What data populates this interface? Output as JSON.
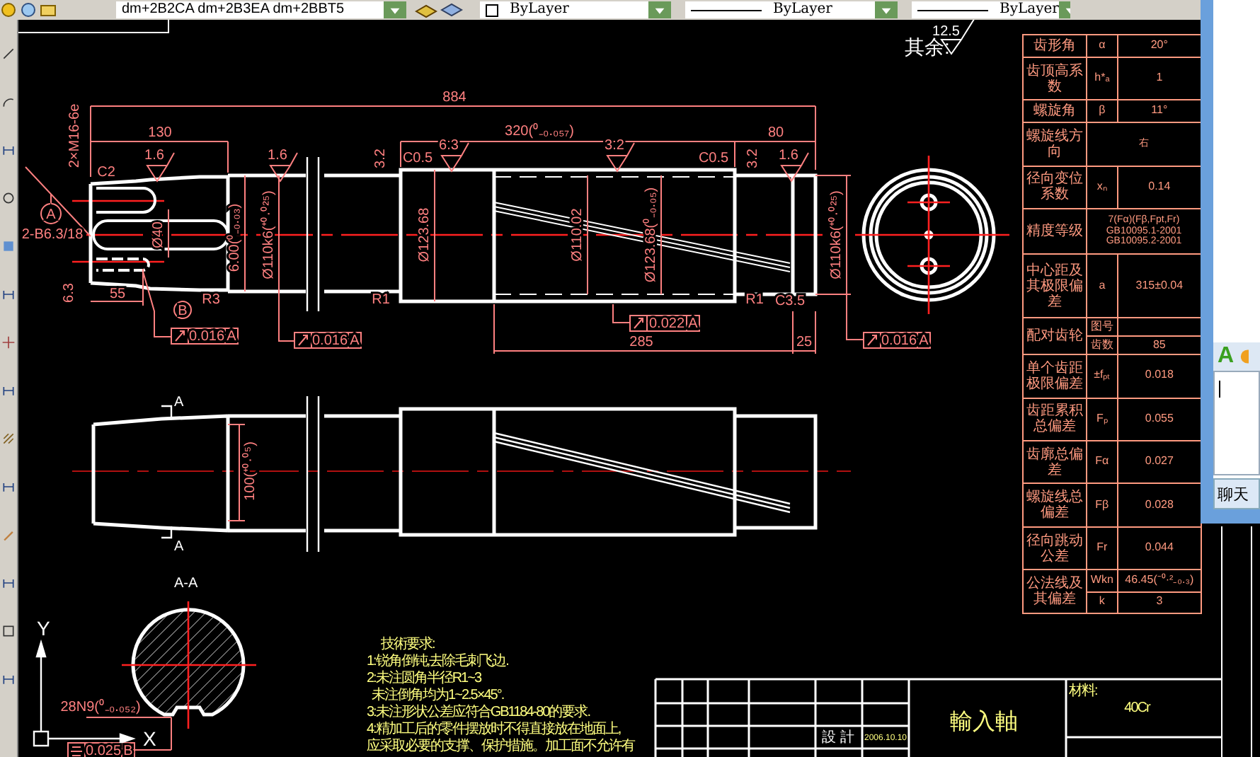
{
  "toolbar": {
    "dim_field": "dm+2B2CA dm+2B3EA dm+2BBT5",
    "layers": [
      "ByLayer",
      "ByLayer",
      "ByLayer"
    ]
  },
  "drawing": {
    "roughness_note": "其余:",
    "roughness_value": "12.5",
    "labels": [
      "2×M16-6e",
      "884",
      "130",
      "320(⁰₋₀.₀₅₇)",
      "80",
      "C2",
      "1.6",
      "1.6",
      "3.2",
      "C0.5",
      "6.3",
      "3.2",
      "C0.5",
      "3.2",
      "1.6",
      "2-B6.3/18",
      "Ø40",
      "6.00(⁰₋₀.₀₃)",
      "Ø110k6(⁺⁰·⁰²⁵)",
      "Ø123.68",
      "Ø110.02",
      "Ø123.68(⁰₋₀.₀₅)",
      "Ø110k6(⁺⁰·⁰²⁵)",
      "6.3",
      "55",
      "R3",
      "R1",
      "R1",
      "C3.5",
      "285",
      "25",
      "100(⁺⁰·⁰⁵)",
      "28N9(⁰₋₀.₀₅₂)"
    ],
    "tolerance_frames": [
      {
        "kind": "runout",
        "value": "0.016",
        "datum": "A"
      },
      {
        "kind": "runout",
        "value": "0.016",
        "datum": "A"
      },
      {
        "kind": "runout",
        "value": "0.022",
        "datum": "A"
      },
      {
        "kind": "runout",
        "value": "0.016",
        "datum": "A"
      },
      {
        "kind": "symmetry",
        "value": "0.025",
        "datum": "B"
      }
    ],
    "datum_marks": [
      "A",
      "B"
    ],
    "section_marks": [
      "A",
      "A"
    ],
    "section_title": "A-A",
    "axis_labels": [
      "Y",
      "X"
    ]
  },
  "gear_table": {
    "rows": [
      {
        "kind": "triple",
        "name": "齿形角",
        "symbol": "α",
        "value": "20°"
      },
      {
        "kind": "triple",
        "name": "齿顶高系数",
        "symbol": "h*ₐ",
        "value": "1"
      },
      {
        "kind": "triple",
        "name": "螺旋角",
        "symbol": "β",
        "value": "11°"
      },
      {
        "kind": "span",
        "name": "螺旋线方向",
        "lines": [
          "右"
        ]
      },
      {
        "kind": "triple",
        "name": "径向变位系数",
        "symbol": "xₙ",
        "value": "0.14"
      },
      {
        "kind": "span",
        "name": "精度等级",
        "lines": [
          "7(Fα)(Fβ,Fpt,Fr)",
          "GB10095.1-2001",
          "GB10095.2-2001"
        ]
      },
      {
        "kind": "triple",
        "name": "中心距及其极限偏差",
        "symbol": "a",
        "value": "315±0.04"
      },
      {
        "kind": "paired",
        "name": "配对齿轮",
        "pairs": [
          {
            "symbol": "图号"
          },
          {
            "symbol": "齿数",
            "value": "85"
          }
        ]
      },
      {
        "kind": "triple",
        "name": "单个齿距极限偏差",
        "symbol": "±fₚₜ",
        "value": "0.018"
      },
      {
        "kind": "triple",
        "name": "齿距累积总偏差",
        "symbol": "Fₚ",
        "value": "0.055"
      },
      {
        "kind": "triple",
        "name": "齿廓总偏差",
        "symbol": "Fα",
        "value": "0.027"
      },
      {
        "kind": "triple",
        "name": "螺旋线总偏差",
        "symbol": "Fβ",
        "value": "0.028"
      },
      {
        "kind": "triple",
        "name": "径向跳动公差",
        "symbol": "Fr",
        "value": "0.044"
      },
      {
        "kind": "paired",
        "name": "公法线及其偏差",
        "pairs": [
          {
            "symbol": "Wkn",
            "value": "46.45(⁻⁰·²₋₀.₃)"
          },
          {
            "symbol": "k",
            "value": "3"
          }
        ]
      }
    ]
  },
  "technical_requirements": {
    "title": "技術要求:",
    "lines": [
      "1:锐角倒钝,去除毛刺飞边.",
      "2:未注圆角半径R1~3",
      "  未注倒角均为1~2.5×45°.",
      "3:未注形状公差应符合GB1184-80的要求.",
      "4:精加工后的零件摆放时不得直接放在地面上,",
      "应采取必要的支撑、保护措施。加工面不允许有"
    ]
  },
  "title_block": {
    "designer_label": "設 計",
    "date": "2006.10.10",
    "part_name": "輸入軸",
    "material_label": "材料:",
    "material": "40Cr"
  },
  "chat_window": {
    "font_button": "A",
    "send_button": "聊天"
  }
}
